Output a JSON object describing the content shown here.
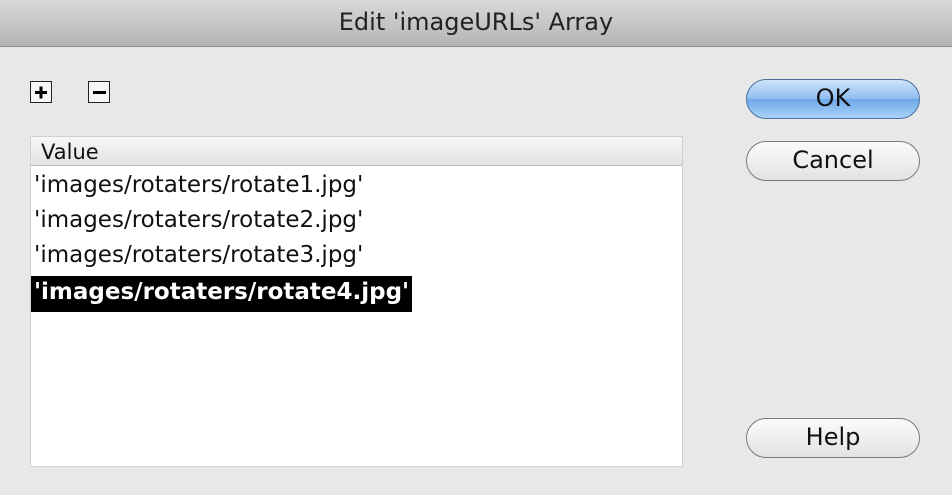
{
  "window": {
    "title": "Edit 'imageURLs' Array"
  },
  "toolbar": {
    "add_icon": "plus-icon",
    "remove_icon": "minus-icon"
  },
  "list": {
    "header": "Value",
    "rows": [
      "'images/rotaters/rotate1.jpg'",
      "'images/rotaters/rotate2.jpg'",
      "'images/rotaters/rotate3.jpg'",
      "'images/rotaters/rotate4.jpg'"
    ],
    "selected_index": 3
  },
  "buttons": {
    "ok": "OK",
    "cancel": "Cancel",
    "help": "Help"
  },
  "colors": {
    "selection_bg": "#000000",
    "primary_button": "#8fbdf0"
  }
}
